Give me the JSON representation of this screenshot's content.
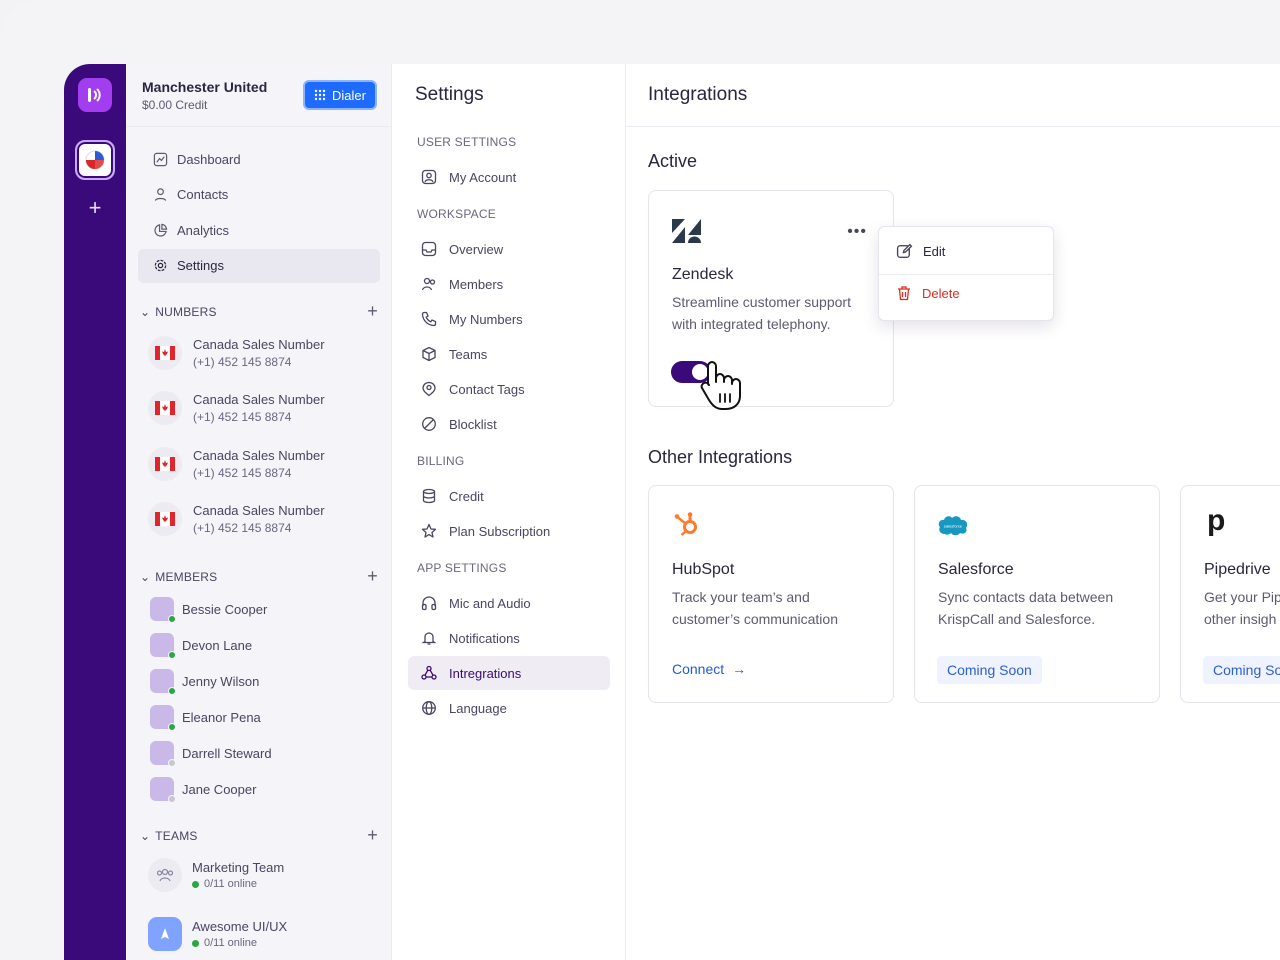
{
  "org": {
    "name": "Manchester United",
    "credit": "$0.00 Credit",
    "dialer_label": "Dialer"
  },
  "nav": [
    {
      "label": "Dashboard",
      "icon": "dashboard-icon"
    },
    {
      "label": "Contacts",
      "icon": "user-icon"
    },
    {
      "label": "Analytics",
      "icon": "pie-chart-icon"
    },
    {
      "label": "Settings",
      "icon": "gear-icon",
      "active": true
    }
  ],
  "numbers": {
    "header": "NUMBERS",
    "items": [
      {
        "name": "Canada Sales Number",
        "number": "(+1) 452 145 8874"
      },
      {
        "name": "Canada Sales Number",
        "number": "(+1) 452 145 8874"
      },
      {
        "name": "Canada Sales Number",
        "number": "(+1) 452 145 8874"
      },
      {
        "name": "Canada Sales Number",
        "number": "(+1) 452 145 8874"
      }
    ]
  },
  "members": {
    "header": "MEMBERS",
    "items": [
      {
        "name": "Bessie Cooper",
        "online": true
      },
      {
        "name": "Devon Lane",
        "online": true
      },
      {
        "name": "Jenny Wilson",
        "online": true
      },
      {
        "name": "Eleanor Pena",
        "online": true
      },
      {
        "name": "Darrell Steward",
        "online": false
      },
      {
        "name": "Jane Cooper",
        "online": false
      }
    ]
  },
  "teams": {
    "header": "TEAMS",
    "items": [
      {
        "name": "Marketing Team",
        "status": "0/11 online"
      },
      {
        "name": "Awesome UI/UX",
        "status": "0/11 online"
      }
    ]
  },
  "settings": {
    "title": "Settings",
    "sections": [
      {
        "label": "USER SETTINGS",
        "items": [
          {
            "label": "My Account",
            "icon": "account-icon"
          }
        ]
      },
      {
        "label": "WORKSPACE",
        "items": [
          {
            "label": "Overview",
            "icon": "overview-icon"
          },
          {
            "label": "Members",
            "icon": "members-icon"
          },
          {
            "label": "My Numbers",
            "icon": "phone-icon"
          },
          {
            "label": "Teams",
            "icon": "cube-icon"
          },
          {
            "label": "Contact Tags",
            "icon": "tag-icon"
          },
          {
            "label": "Blocklist",
            "icon": "block-icon"
          }
        ]
      },
      {
        "label": "BILLING",
        "items": [
          {
            "label": "Credit",
            "icon": "database-icon"
          },
          {
            "label": "Plan Subscription",
            "icon": "star-icon"
          }
        ]
      },
      {
        "label": "APP SETTINGS",
        "items": [
          {
            "label": "Mic and Audio",
            "icon": "headphones-icon"
          },
          {
            "label": "Notifications",
            "icon": "bell-icon"
          },
          {
            "label": "Intregrations",
            "icon": "integrations-icon",
            "active": true
          },
          {
            "label": "Language",
            "icon": "globe-icon"
          }
        ]
      }
    ]
  },
  "main": {
    "title": "Integrations",
    "active_heading": "Active",
    "other_heading": "Other Integrations",
    "active_card": {
      "name": "Zendesk",
      "desc_line1": "Streamline customer support",
      "desc_line2": "with integrated telephony.",
      "enabled": true
    },
    "menu": {
      "edit": "Edit",
      "delete": "Delete"
    },
    "other_cards": [
      {
        "name": "HubSpot",
        "desc_line1": "Track your team’s and",
        "desc_line2": "customer’s communication",
        "action": "Connect"
      },
      {
        "name": "Salesforce",
        "desc_line1": "Sync contacts data between",
        "desc_line2": "KrispCall and Salesforce.",
        "action": "Coming Soon"
      },
      {
        "name": "Pipedrive",
        "desc_line1": "Get your Pip",
        "desc_line2": "other insigh",
        "action": "Coming So"
      }
    ]
  },
  "colors": {
    "brand": "#3b0a7a",
    "accent": "#1f6bff",
    "danger": "#d92d20",
    "link": "#1f5bd8"
  }
}
